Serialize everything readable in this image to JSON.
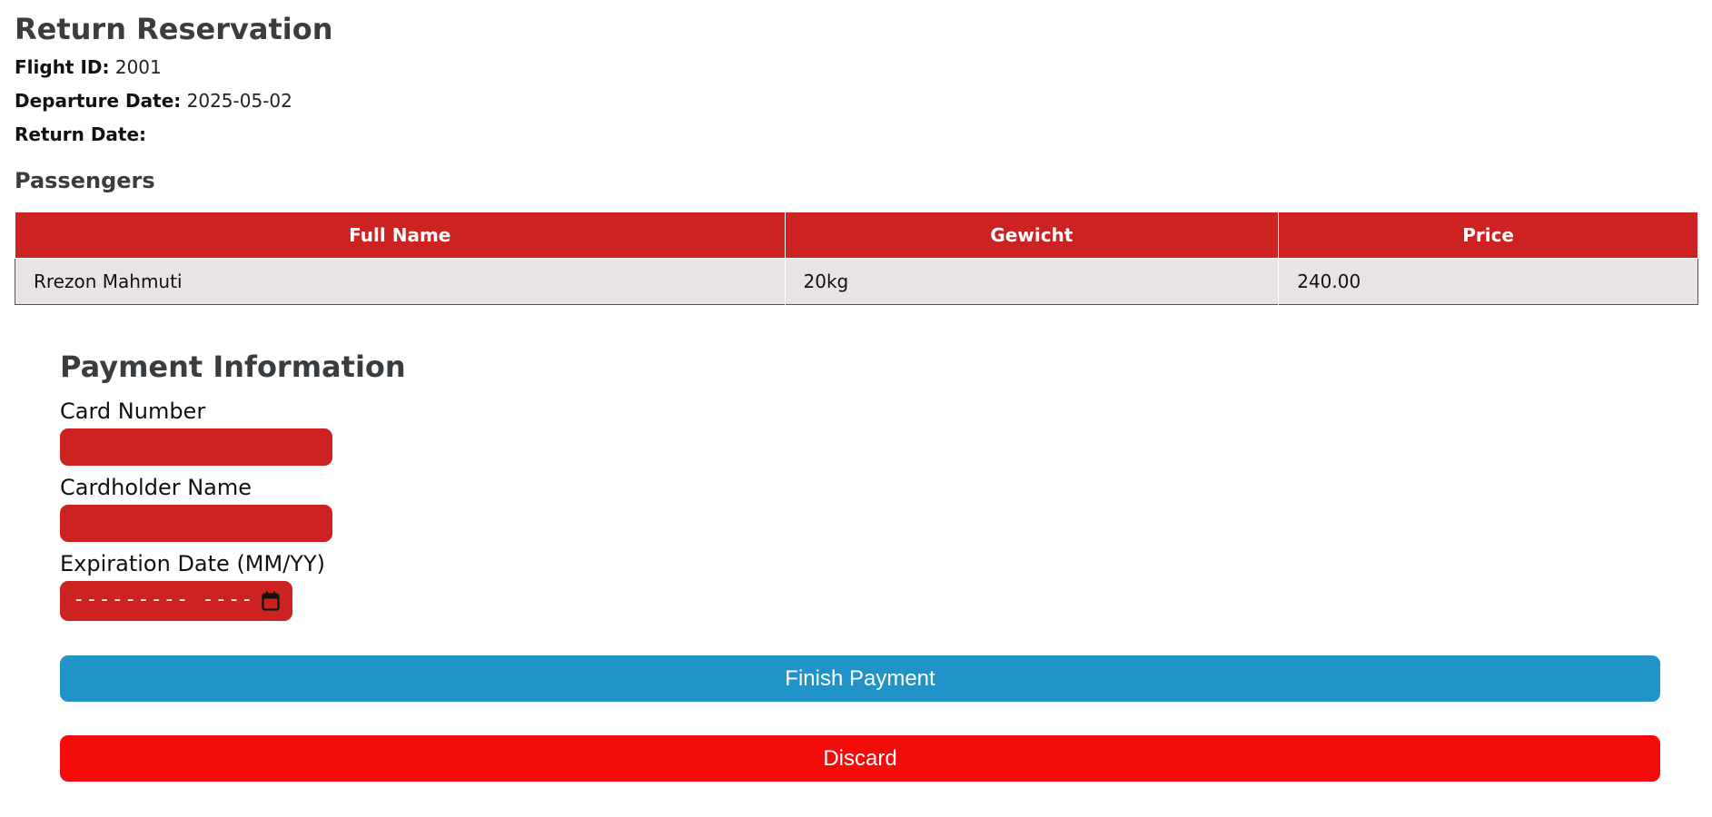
{
  "reservation": {
    "title": "Return Reservation",
    "flight_label": "Flight ID:",
    "flight_id": "2001",
    "departure_label": "Departure Date:",
    "departure_date": "2025-05-02",
    "return_label": "Return Date:",
    "return_date": ""
  },
  "passengers": {
    "heading": "Passengers",
    "columns": [
      "Full Name",
      "Gewicht",
      "Price"
    ],
    "rows": [
      {
        "full_name": "Rrezon Mahmuti",
        "weight": "20kg",
        "price": "240.00"
      }
    ]
  },
  "payment": {
    "heading": "Payment Information",
    "card_number_label": "Card Number",
    "card_number_value": "",
    "cardholder_label": "Cardholder Name",
    "cardholder_value": "",
    "expiration_label": "Expiration Date (MM/YY)",
    "expiration_placeholder": "--------- ----",
    "finish_label": "Finish Payment",
    "discard_label": "Discard"
  },
  "colors": {
    "accent_red": "#cc2222",
    "finish_blue": "#2094c9",
    "discard_red": "#f40c0c",
    "row_background": "#e8e4e4"
  },
  "icons": {
    "date_picker": "calendar-icon"
  }
}
